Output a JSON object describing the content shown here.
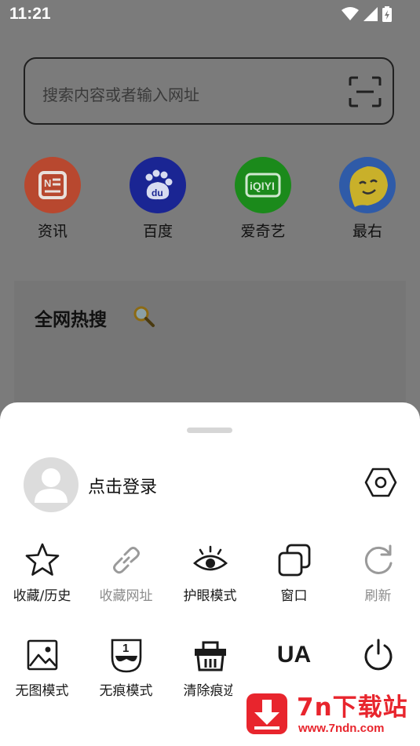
{
  "status_bar": {
    "time": "11:21"
  },
  "search": {
    "placeholder": "搜索内容或者输入网址"
  },
  "shortcuts": [
    {
      "label": "资讯",
      "icon": "news-icon",
      "color": "#b8482f"
    },
    {
      "label": "百度",
      "icon": "baidu-paw-icon",
      "color": "#1a2593"
    },
    {
      "label": "爱奇艺",
      "icon": "iqiyi-icon",
      "color": "#1b8a1b"
    },
    {
      "label": "最右",
      "icon": "zuiyou-icon",
      "color": "#2f5ba8"
    }
  ],
  "hot_search": {
    "title": "全网热搜"
  },
  "sheet": {
    "login_text": "点击登录",
    "row1": [
      {
        "label": "收藏/历史",
        "icon": "star-icon",
        "enabled": true
      },
      {
        "label": "收藏网址",
        "icon": "link-icon",
        "enabled": false
      },
      {
        "label": "护眼模式",
        "icon": "eye-icon",
        "enabled": true
      },
      {
        "label": "窗口",
        "icon": "windows-icon",
        "enabled": true
      },
      {
        "label": "刷新",
        "icon": "refresh-icon",
        "enabled": false
      }
    ],
    "row2": [
      {
        "label": "无图模式",
        "icon": "image-icon",
        "enabled": true
      },
      {
        "label": "无痕模式",
        "icon": "incognito-mask-icon",
        "enabled": true
      },
      {
        "label": "清除痕迹",
        "icon": "clear-basket-icon",
        "enabled": true
      },
      {
        "label": "UA",
        "icon": "ua-text-icon",
        "enabled": true
      },
      {
        "label": "",
        "icon": "power-icon",
        "enabled": true
      }
    ]
  },
  "watermark": {
    "title": "7n下载站",
    "url": "www.7ndn.com"
  }
}
